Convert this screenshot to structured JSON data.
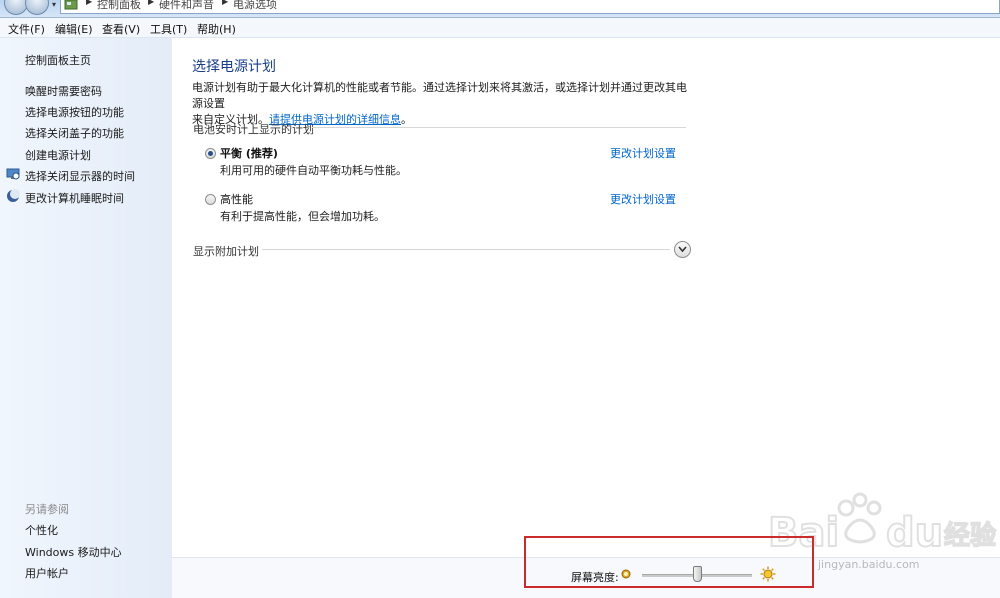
{
  "address": {
    "crumbs": [
      "控制面板",
      "硬件和声音",
      "电源选项"
    ]
  },
  "menu": {
    "items": [
      "文件(F)",
      "编辑(E)",
      "查看(V)",
      "工具(T)",
      "帮助(H)"
    ]
  },
  "left": {
    "home": "控制面板主页",
    "links": [
      "唤醒时需要密码",
      "选择电源按钮的功能",
      "选择关闭盖子的功能",
      "创建电源计划",
      "选择关闭显示器的时间",
      "更改计算机睡眠时间"
    ],
    "see_also_heading": "另请参阅",
    "see_also": [
      "个性化",
      "Windows 移动中心",
      "用户帐户"
    ]
  },
  "main": {
    "title": "选择电源计划",
    "desc_line1": "电源计划有助于最大化计算机的性能或者节能。通过选择计划来将其激活，或选择计划并通过更改其电源设置",
    "desc_line2_prefix": "来自定义计划。",
    "desc_link": "请提供电源计划的详细信息",
    "desc_suffix": "。",
    "section_label": "电池安时计上显示的计划",
    "plans": [
      {
        "name": "平衡 (推荐)",
        "desc": "利用可用的硬件自动平衡功耗与性能。",
        "selected": true,
        "change_link": "更改计划设置"
      },
      {
        "name": "高性能",
        "desc": "有利于提高性能，但会增加功耗。",
        "selected": false,
        "change_link": "更改计划设置"
      }
    ],
    "extra_plans_label": "显示附加计划"
  },
  "brightness": {
    "label": "屏幕亮度:",
    "level_fraction": 0.5
  },
  "watermark": {
    "text": "jingyan.baidu.com"
  },
  "colors": {
    "title": "#1a3e8c",
    "link": "#0066cc",
    "highlight_box": "#cc2b2b"
  }
}
